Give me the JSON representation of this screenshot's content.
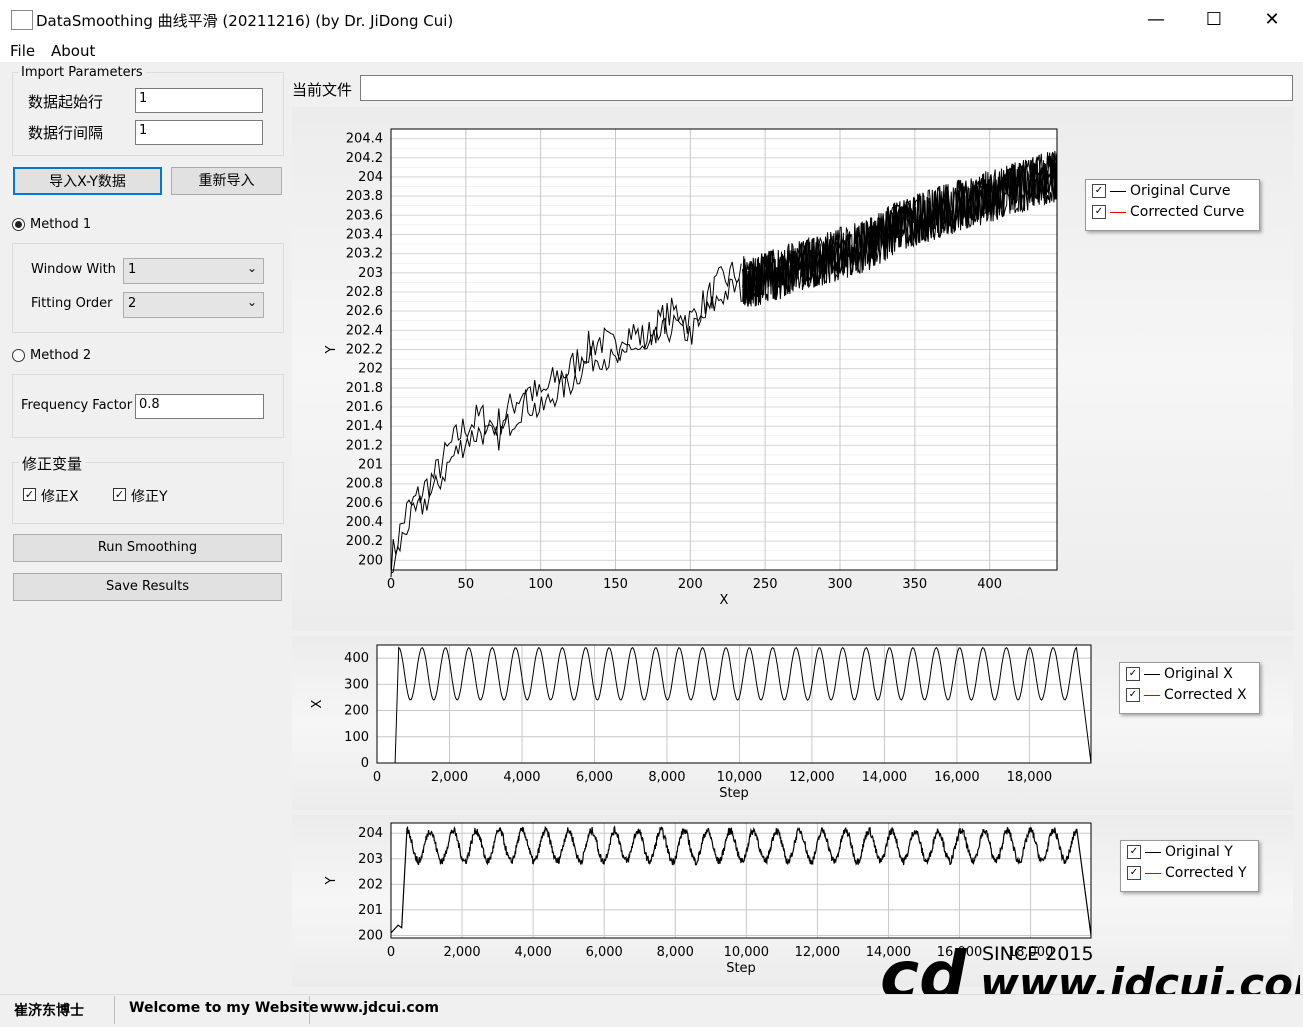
{
  "window": {
    "title": "DataSmoothing 曲线平滑 (20211216) (by Dr. JiDong Cui)",
    "minimize": "—",
    "maximize": "☐",
    "close": "✕"
  },
  "menu": [
    "File",
    "About"
  ],
  "import": {
    "group_label": "Import Parameters",
    "start_row_label": "数据起始行",
    "start_row_value": "1",
    "row_interval_label": "数据行间隔",
    "row_interval_value": "1"
  },
  "buttons": {
    "import_xy": "导入X-Y数据",
    "reimport": "重新导入",
    "run": "Run Smoothing",
    "save": "Save Results"
  },
  "method1": {
    "label": "Method 1",
    "selected": true,
    "window_label": "Window With",
    "window_value": "1",
    "order_label": "Fitting Order",
    "order_value": "2"
  },
  "method2": {
    "label": "Method 2",
    "selected": false,
    "freq_label": "Frequency Factor",
    "freq_value": "0.8"
  },
  "correct": {
    "group_label": "修正变量",
    "x_label": "修正X",
    "x_checked": true,
    "y_label": "修正Y",
    "y_checked": true
  },
  "file": {
    "label": "当前文件",
    "value": ""
  },
  "legend_main": {
    "original": "Original Curve",
    "corrected": "Corrected Curve"
  },
  "legend_x": {
    "original": "Original X",
    "corrected": "Corrected X"
  },
  "legend_y": {
    "original": "Original Y",
    "corrected": "Corrected Y"
  },
  "colors": {
    "original": "#000000",
    "corrected": "#e00000",
    "grid": "#c8c8c8"
  },
  "status": {
    "name": "崔济东博士",
    "welcome": "Welcome to my Website",
    "url": "www.jdcui.com"
  },
  "watermark": {
    "logo": "cd",
    "since": "SINCE 2015",
    "site": "www.jdcui.com"
  },
  "chart_data": [
    {
      "type": "line",
      "xlabel": "X",
      "ylabel": "Y",
      "xlim": [
        0,
        445
      ],
      "ylim": [
        199.9,
        204.5
      ],
      "xticks": [
        "0",
        "50",
        "100",
        "150",
        "200",
        "250",
        "300",
        "350",
        "400"
      ],
      "yticks": [
        "200",
        "200.2",
        "200.4",
        "200.6",
        "200.8",
        "201",
        "201.2",
        "201.4",
        "201.6",
        "201.8",
        "202",
        "202.2",
        "202.4",
        "202.6",
        "202.8",
        "203",
        "203.2",
        "203.4",
        "203.6",
        "203.8",
        "204",
        "204.2",
        "204.4"
      ],
      "series": [
        {
          "name": "Original Curve",
          "x": [
            0,
            10,
            20,
            30,
            40,
            50,
            60,
            70,
            80,
            90,
            100,
            110,
            120,
            130,
            140,
            150,
            160,
            170,
            180,
            190,
            200,
            210,
            220,
            230,
            240,
            260,
            280,
            300,
            320,
            340,
            360,
            380,
            400,
            420,
            440
          ],
          "y": [
            200.0,
            200.5,
            200.7,
            200.9,
            201.2,
            201.4,
            201.5,
            201.4,
            201.6,
            201.8,
            201.7,
            201.9,
            202.0,
            202.2,
            202.3,
            202.2,
            202.4,
            202.3,
            202.5,
            202.6,
            202.5,
            202.7,
            202.9,
            203.0,
            202.9,
            203.0,
            203.1,
            203.2,
            203.3,
            203.5,
            203.6,
            203.7,
            203.8,
            203.9,
            204.0
          ]
        },
        {
          "name": "Corrected Curve",
          "x": [],
          "y": []
        }
      ]
    },
    {
      "type": "line",
      "xlabel": "Step",
      "ylabel": "X",
      "xlim": [
        0,
        19700
      ],
      "ylim": [
        0,
        450
      ],
      "xticks": [
        "0",
        "2,000",
        "4,000",
        "6,000",
        "8,000",
        "10,000",
        "12,000",
        "14,000",
        "16,000",
        "18,000"
      ],
      "yticks": [
        "0",
        "100",
        "200",
        "300",
        "400"
      ],
      "series": [
        {
          "name": "Original X",
          "cycles": 29,
          "min": 240,
          "max": 440
        },
        {
          "name": "Corrected X",
          "values": []
        }
      ]
    },
    {
      "type": "line",
      "xlabel": "Step",
      "ylabel": "Y",
      "xlim": [
        0,
        19700
      ],
      "ylim": [
        199.9,
        204.4
      ],
      "xticks": [
        "0",
        "2,000",
        "4,000",
        "6,000",
        "8,000",
        "10,000",
        "12,000",
        "14,000",
        "16,000",
        "18,000"
      ],
      "yticks": [
        "200",
        "201",
        "202",
        "203",
        "204"
      ],
      "series": [
        {
          "name": "Original Y",
          "cycles": 29,
          "min": 202.9,
          "max": 204.1
        },
        {
          "name": "Corrected Y",
          "values": []
        }
      ]
    }
  ]
}
